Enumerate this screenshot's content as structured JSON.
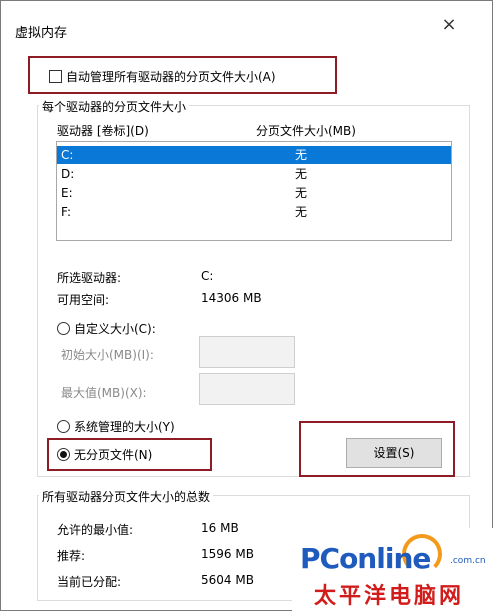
{
  "window": {
    "title": "虚拟内存",
    "close_glyph": "×"
  },
  "auto_manage": {
    "label": "自动管理所有驱动器的分页文件大小(A)",
    "checked": false
  },
  "per_drive": {
    "group_title": "每个驱动器的分页文件大小",
    "col_drive": "驱动器 [卷标](D)",
    "col_size": "分页文件大小(MB)",
    "rows": [
      {
        "drive": "C:",
        "size": "无",
        "selected": true
      },
      {
        "drive": "D:",
        "size": "无",
        "selected": false
      },
      {
        "drive": "E:",
        "size": "无",
        "selected": false
      },
      {
        "drive": "F:",
        "size": "无",
        "selected": false
      }
    ],
    "selected_label": "所选驱动器:",
    "selected_value": "C:",
    "free_label": "可用空间:",
    "free_value": "14306 MB",
    "custom_label": "自定义大小(C):",
    "initial_label": "初始大小(MB)(I):",
    "max_label": "最大值(MB)(X):",
    "system_label": "系统管理的大小(Y)",
    "none_label": "无分页文件(N)",
    "selected_option": "none",
    "set_button": "设置(S)"
  },
  "totals": {
    "group_title": "所有驱动器分页文件大小的总数",
    "min_label": "允许的最小值:",
    "min_value": "16 MB",
    "rec_label": "推荐:",
    "rec_value": "1596 MB",
    "cur_label": "当前已分配:",
    "cur_value": "5604 MB"
  },
  "watermark": {
    "brand": "PCon",
    "brand_tail": "line",
    "domain": ".com.cn",
    "cn": "太平洋电脑网"
  },
  "colors": {
    "highlight": "#8e1c24",
    "selection": "#0a78d7"
  }
}
